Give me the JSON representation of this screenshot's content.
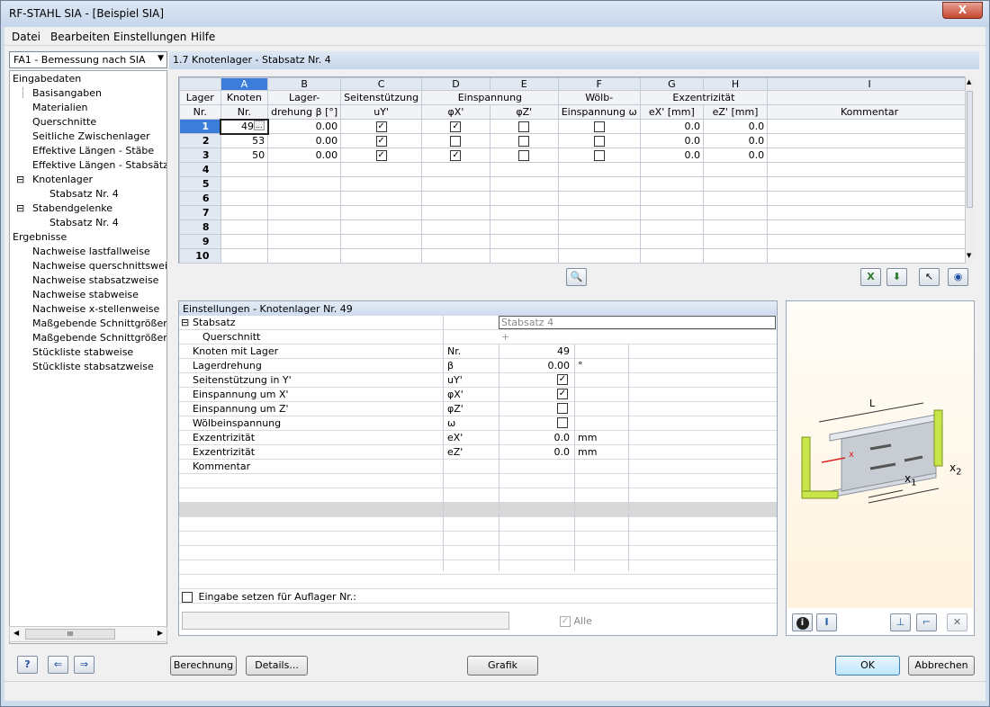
{
  "window": {
    "title": "RF-STAHL SIA - [Beispiel SIA]",
    "close": "X"
  },
  "menu": [
    "Datei",
    "Bearbeiten",
    "Einstellungen",
    "Hilfe"
  ],
  "case_combo": {
    "value": "FA1 - Bemessung nach SIA"
  },
  "nav": {
    "input_header": "Eingabedaten",
    "input_items": [
      "Basisangaben",
      "Materialien",
      "Querschnitte",
      "Seitliche Zwischenlager",
      "Effektive Längen - Stäbe",
      "Effektive Längen - Stabsätze",
      "Knotenlager",
      "Stabsatz Nr. 4",
      "Stabendgelenke",
      "Stabsatz Nr. 4"
    ],
    "results_header": "Ergebnisse",
    "result_items": [
      "Nachweise lastfallweise",
      "Nachweise querschnittsweise",
      "Nachweise stabsatzweise",
      "Nachweise stabweise",
      "Nachweise x-stellenweise",
      "Maßgebende Schnittgrößen sta",
      "Maßgebende Schnittgrößen sta",
      "Stückliste stabweise",
      "Stückliste stabsatzweise"
    ],
    "scroll_thumb": "III"
  },
  "section_title": "1.7 Knotenlager - Stabsatz Nr. 4",
  "grid": {
    "col_letters": [
      "A",
      "B",
      "C",
      "D",
      "E",
      "F",
      "G",
      "H",
      "I"
    ],
    "hdr1": {
      "lager": "Lager",
      "knoten": "Knoten",
      "dreh": "Lager-",
      "seiten": "Seitenstützung",
      "einsp": "Einspannung",
      "woelb": "Wölb-",
      "exz": "Exzentrizität"
    },
    "hdr2": {
      "lager": "Nr.",
      "knoten": "Nr.",
      "dreh": "drehung β [°]",
      "uy": "uY'",
      "phix": "φX'",
      "phiz": "φZ'",
      "woelb": "Einspannung ω",
      "ex": "eX' [mm]",
      "ez": "eZ' [mm]",
      "kommentar": "Kommentar"
    },
    "rows": [
      {
        "nr": "1",
        "knoten": "49",
        "dreh": "0.00",
        "uy": true,
        "phix": true,
        "phiz": false,
        "w": false,
        "ex": "0.0",
        "ez": "0.0"
      },
      {
        "nr": "2",
        "knoten": "53",
        "dreh": "0.00",
        "uy": true,
        "phix": false,
        "phiz": false,
        "w": false,
        "ex": "0.0",
        "ez": "0.0"
      },
      {
        "nr": "3",
        "knoten": "50",
        "dreh": "0.00",
        "uy": true,
        "phix": true,
        "phiz": false,
        "w": false,
        "ex": "0.0",
        "ez": "0.0"
      },
      {
        "nr": "4"
      },
      {
        "nr": "5"
      },
      {
        "nr": "6"
      },
      {
        "nr": "7"
      },
      {
        "nr": "8"
      },
      {
        "nr": "9"
      },
      {
        "nr": "10"
      }
    ],
    "ellipsis": "..."
  },
  "settings": {
    "title": "Einstellungen - Knotenlager Nr. 49",
    "stabsatz_label": "Stabsatz",
    "stabsatz_value": "Stabsatz 4",
    "querschnitt_label": "Querschnitt",
    "querschnitt_value": "+",
    "rows": [
      {
        "label": "Knoten mit Lager",
        "sym": "Nr.",
        "value": "49",
        "unit": ""
      },
      {
        "label": "Lagerdrehung",
        "sym": "β",
        "value": "0.00",
        "unit": "°"
      },
      {
        "label": "Seitenstützung in Y'",
        "sym": "uY'",
        "check": true,
        "unit": ""
      },
      {
        "label": "Einspannung um X'",
        "sym": "φX'",
        "check": true,
        "unit": ""
      },
      {
        "label": "Einspannung um Z'",
        "sym": "φZ'",
        "check": false,
        "unit": ""
      },
      {
        "label": "Wölbeinspannung",
        "sym": "ω",
        "check": false,
        "unit": ""
      },
      {
        "label": "Exzentrizität",
        "sym": "eX'",
        "value": "0.0",
        "unit": "mm"
      },
      {
        "label": "Exzentrizität",
        "sym": "eZ'",
        "value": "0.0",
        "unit": "mm"
      },
      {
        "label": "Kommentar",
        "sym": "",
        "value": "",
        "unit": ""
      }
    ],
    "eingabe_label": "Eingabe setzen für Auflager Nr.:",
    "alle_label": "Alle"
  },
  "graphic": {
    "L": "L",
    "x": "x",
    "x1": "x",
    "x1_sub": "1",
    "x2": "x",
    "x2_sub": "2"
  },
  "buttons": {
    "berechnung": "Berechnung",
    "details": "Details...",
    "grafik": "Grafik",
    "ok": "OK",
    "abbrechen": "Abbrechen"
  },
  "colors": {
    "accent": "#3b7dd8",
    "support": "#c8e64a"
  }
}
